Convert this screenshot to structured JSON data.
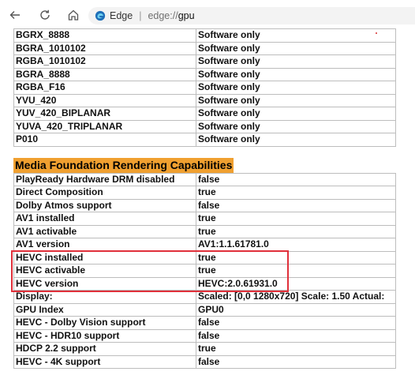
{
  "browser": {
    "site_name": "Edge",
    "url_scheme": "edge://",
    "url_host": "gpu"
  },
  "formats": [
    {
      "name": "BGRX_8888",
      "value": "Software only"
    },
    {
      "name": "BGRA_1010102",
      "value": "Software only"
    },
    {
      "name": "RGBA_1010102",
      "value": "Software only"
    },
    {
      "name": "BGRA_8888",
      "value": "Software only"
    },
    {
      "name": "RGBA_F16",
      "value": "Software only"
    },
    {
      "name": "YVU_420",
      "value": "Software only"
    },
    {
      "name": "YUV_420_BIPLANAR",
      "value": "Software only"
    },
    {
      "name": "YUVA_420_TRIPLANAR",
      "value": "Software only"
    },
    {
      "name": "P010",
      "value": "Software only"
    }
  ],
  "media_foundation": {
    "title": "Media Foundation Rendering Capabilities",
    "rows": [
      {
        "name": "PlayReady Hardware DRM disabled",
        "value": "false"
      },
      {
        "name": "Direct Composition",
        "value": "true"
      },
      {
        "name": "Dolby Atmos support",
        "value": "false"
      },
      {
        "name": "AV1 installed",
        "value": "true"
      },
      {
        "name": "AV1 activable",
        "value": "true"
      },
      {
        "name": "AV1 version",
        "value": "AV1:1.1.61781.0"
      },
      {
        "name": "HEVC installed",
        "value": "true"
      },
      {
        "name": "HEVC activable",
        "value": "true"
      },
      {
        "name": "HEVC version",
        "value": "HEVC:2.0.61931.0"
      },
      {
        "name": "Display:",
        "value": "Scaled: [0,0 1280x720] Scale: 1.50 Actual:"
      },
      {
        "name": "GPU Index",
        "value": "GPU0"
      },
      {
        "name": "HEVC - Dolby Vision support",
        "value": "false"
      },
      {
        "name": "HEVC - HDR10 support",
        "value": "false"
      },
      {
        "name": "HDCP 2.2 support",
        "value": "true"
      },
      {
        "name": "HEVC - 4K support",
        "value": "false"
      }
    ]
  },
  "colors": {
    "section_highlight": "#f0a030",
    "annotation_box": "#e0303a"
  },
  "icons": [
    "back-arrow-icon",
    "refresh-icon",
    "home-icon",
    "edge-logo-icon"
  ]
}
